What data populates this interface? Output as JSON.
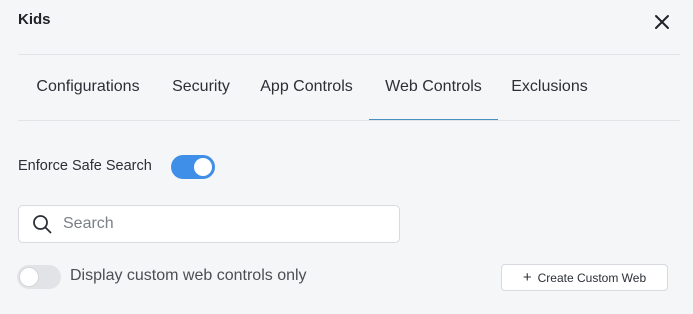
{
  "header": {
    "title": "Kids",
    "close_icon": "close-icon"
  },
  "tabs": [
    {
      "label": "Configurations",
      "active": false
    },
    {
      "label": "Security",
      "active": false
    },
    {
      "label": "App Controls",
      "active": false
    },
    {
      "label": "Web Controls",
      "active": true
    },
    {
      "label": "Exclusions",
      "active": false
    }
  ],
  "safe_search": {
    "label": "Enforce Safe Search",
    "enabled": true
  },
  "search": {
    "icon": "search-icon",
    "placeholder": "Search",
    "value": ""
  },
  "custom_only": {
    "label": "Display custom web controls only",
    "enabled": false
  },
  "create_button": {
    "icon": "plus-icon",
    "label": "Create Custom Web"
  },
  "colors": {
    "accent": "#3f8fe8",
    "tab_underline": "#4a8fc2",
    "background": "#f5f6f8"
  }
}
